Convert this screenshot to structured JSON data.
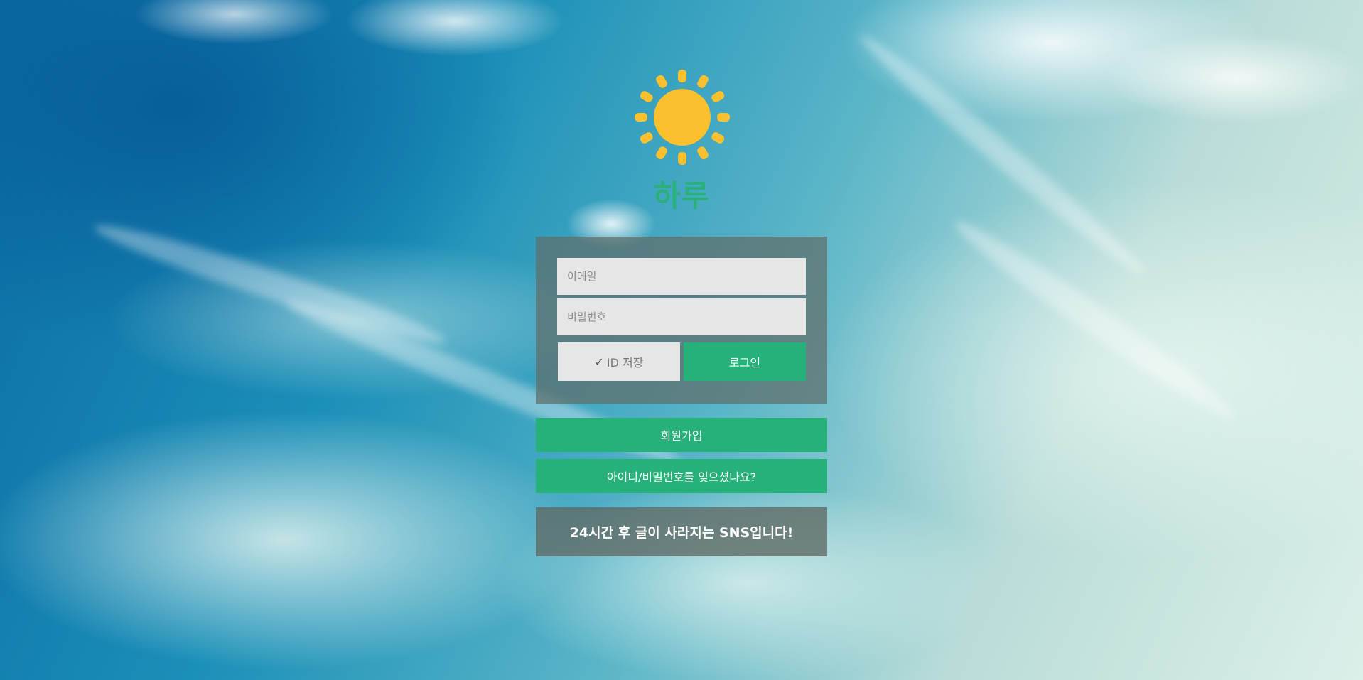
{
  "brand": {
    "logo_icon": "sun-icon",
    "name": "하루",
    "sun_color": "#FBC02D",
    "accent_color": "#26B07A"
  },
  "login_form": {
    "email_placeholder": "이메일",
    "password_placeholder": "비밀번호",
    "save_id_check": "✓",
    "save_id_label": "ID 저장",
    "login_label": "로그인"
  },
  "actions": {
    "signup_label": "회원가입",
    "forgot_label": "아이디/비밀번호를 잊으셨나요?"
  },
  "tagline": "24시간 후 글이 사라지는 SNS입니다!"
}
